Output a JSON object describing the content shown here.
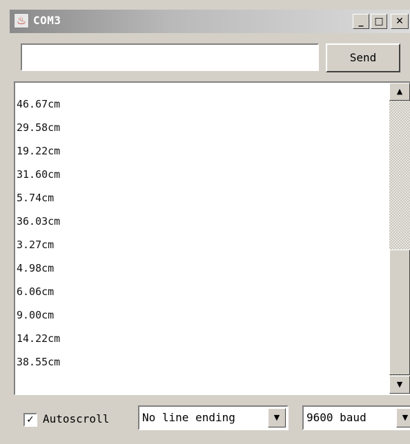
{
  "window": {
    "title": "COM3",
    "icons": {
      "app": "java-icon",
      "minimize": "minimize-icon",
      "maximize": "maximize-icon",
      "close": "close-icon"
    }
  },
  "send": {
    "input_value": "",
    "input_placeholder": "",
    "button_label": "Send"
  },
  "output": {
    "lines": [
      "46.67cm",
      "29.58cm",
      "19.22cm",
      "31.60cm",
      "5.74cm",
      "36.03cm",
      "3.27cm",
      "4.98cm",
      "6.06cm",
      "9.00cm",
      "14.22cm",
      "38.55cm"
    ]
  },
  "footer": {
    "autoscroll_label": "Autoscroll",
    "autoscroll_checked": true,
    "line_ending": "No line ending",
    "baud_rate": "9600 baud"
  }
}
